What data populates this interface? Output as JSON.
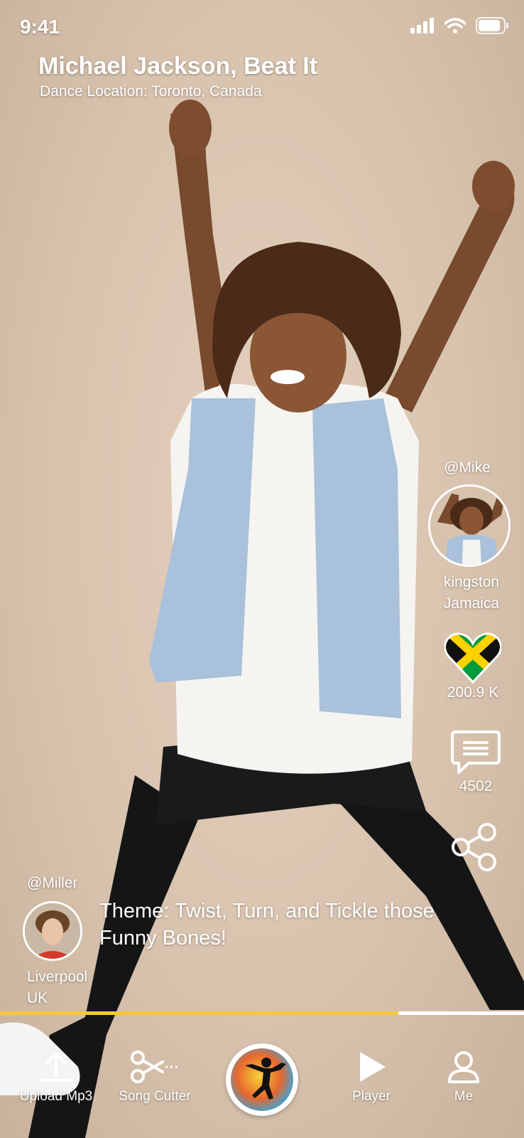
{
  "status_bar": {
    "time": "9:41"
  },
  "header": {
    "title": "Michael Jackson, Beat It",
    "subtitle": "Dance Location: Toronto, Canada"
  },
  "creator": {
    "handle": "@Mike",
    "city": "kingston",
    "country": "Jamaica",
    "likes": "200.9 K",
    "comments": "4502"
  },
  "poster": {
    "handle": "@Miller",
    "city": "Liverpool",
    "country": "UK",
    "theme": "Theme: Twist, Turn, and Tickle those Funny Bones!"
  },
  "progress": {
    "fraction": 0.76,
    "fill_color": "#f4c93a",
    "track_color": "#ffffff"
  },
  "bottom_nav": {
    "upload": "Upload Mp3",
    "cutter": "Song Cutter",
    "player": "Player",
    "me": "Me"
  }
}
